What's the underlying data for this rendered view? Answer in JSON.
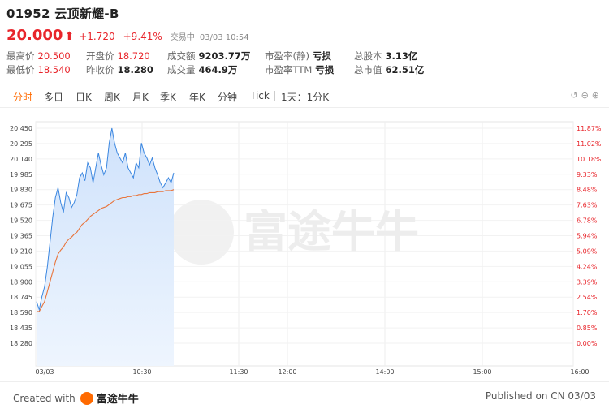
{
  "header": {
    "code": "01952",
    "name": "云顶新耀-B",
    "price": "20.000",
    "change": "+1.720",
    "change_pct": "+9.41%",
    "status": "交易中",
    "time": "03/03 10:54"
  },
  "stats": {
    "row1": [
      {
        "label": "最高价",
        "value": "20.500",
        "red": true
      },
      {
        "label": "开盘价",
        "value": "18.720",
        "red": true
      },
      {
        "label": "成交额",
        "value": "9203.77万",
        "red": false
      },
      {
        "label": "市盈率(静)",
        "value": "亏损",
        "red": false
      },
      {
        "label": "总股本",
        "value": "3.13亿",
        "red": false
      }
    ],
    "row2": [
      {
        "label": "最低价",
        "value": "18.540",
        "red": true
      },
      {
        "label": "昨收价",
        "value": "18.280",
        "red": false
      },
      {
        "label": "成交量",
        "value": "464.9万",
        "red": false
      },
      {
        "label": "市盈率TTM",
        "value": "亏损",
        "red": false
      },
      {
        "label": "总市值",
        "value": "62.51亿",
        "red": false
      }
    ]
  },
  "tabs": [
    "分时",
    "多日",
    "日K",
    "周K",
    "月K",
    "季K",
    "年K",
    "分钟",
    "Tick",
    "1天：1分K"
  ],
  "active_tab": "分时",
  "colors": {
    "up": "#e8252b",
    "price_line": "#3a86e0",
    "avg_line": "#e8743b",
    "accent": "#ff6a00"
  },
  "watermark": "富途牛牛",
  "footer": {
    "created_prefix": "Created with",
    "brand": "富途牛牛",
    "published": "Published on CN 03/03"
  },
  "chart_data": {
    "type": "line",
    "prev_close": 18.28,
    "x_tick_labels": [
      "03/03",
      "10:30",
      "11:30",
      "12:00",
      "14:00",
      "15:00",
      "16:00"
    ],
    "y_left_ticks": [
      "20.450",
      "20.295",
      "20.140",
      "19.985",
      "19.830",
      "19.675",
      "19.520",
      "19.365",
      "19.210",
      "19.055",
      "18.900",
      "18.745",
      "18.590",
      "18.435",
      "18.280"
    ],
    "y_right_ticks": [
      "11.87%",
      "11.02%",
      "10.18%",
      "9.33%",
      "8.48%",
      "7.63%",
      "6.78%",
      "5.94%",
      "5.09%",
      "4.24%",
      "3.39%",
      "2.54%",
      "1.70%",
      "0.85%",
      "0.00%"
    ],
    "ylim": [
      18.28,
      20.45
    ],
    "series": [
      {
        "name": "price",
        "values": [
          18.7,
          18.62,
          18.75,
          18.85,
          19.05,
          19.3,
          19.55,
          19.75,
          19.85,
          19.7,
          19.6,
          19.8,
          19.75,
          19.65,
          19.7,
          19.78,
          19.95,
          20.0,
          19.92,
          20.1,
          20.05,
          19.9,
          20.05,
          20.2,
          20.08,
          19.98,
          20.05,
          20.3,
          20.45,
          20.3,
          20.2,
          20.15,
          20.1,
          20.2,
          20.05,
          20.0,
          19.95,
          20.1,
          20.05,
          20.3,
          20.2,
          20.15,
          20.08,
          20.15,
          20.05,
          19.98,
          19.9,
          19.85,
          19.9,
          19.95,
          19.9,
          20.0
        ]
      },
      {
        "name": "avg",
        "values": [
          18.6,
          18.6,
          18.65,
          18.7,
          18.8,
          18.9,
          19.0,
          19.1,
          19.18,
          19.22,
          19.25,
          19.3,
          19.33,
          19.35,
          19.38,
          19.4,
          19.44,
          19.48,
          19.5,
          19.53,
          19.56,
          19.58,
          19.6,
          19.62,
          19.64,
          19.65,
          19.66,
          19.68,
          19.7,
          19.72,
          19.73,
          19.74,
          19.75,
          19.75,
          19.76,
          19.76,
          19.77,
          19.77,
          19.78,
          19.78,
          19.79,
          19.79,
          19.8,
          19.8,
          19.8,
          19.81,
          19.81,
          19.81,
          19.82,
          19.82,
          19.82,
          19.83
        ]
      }
    ]
  }
}
